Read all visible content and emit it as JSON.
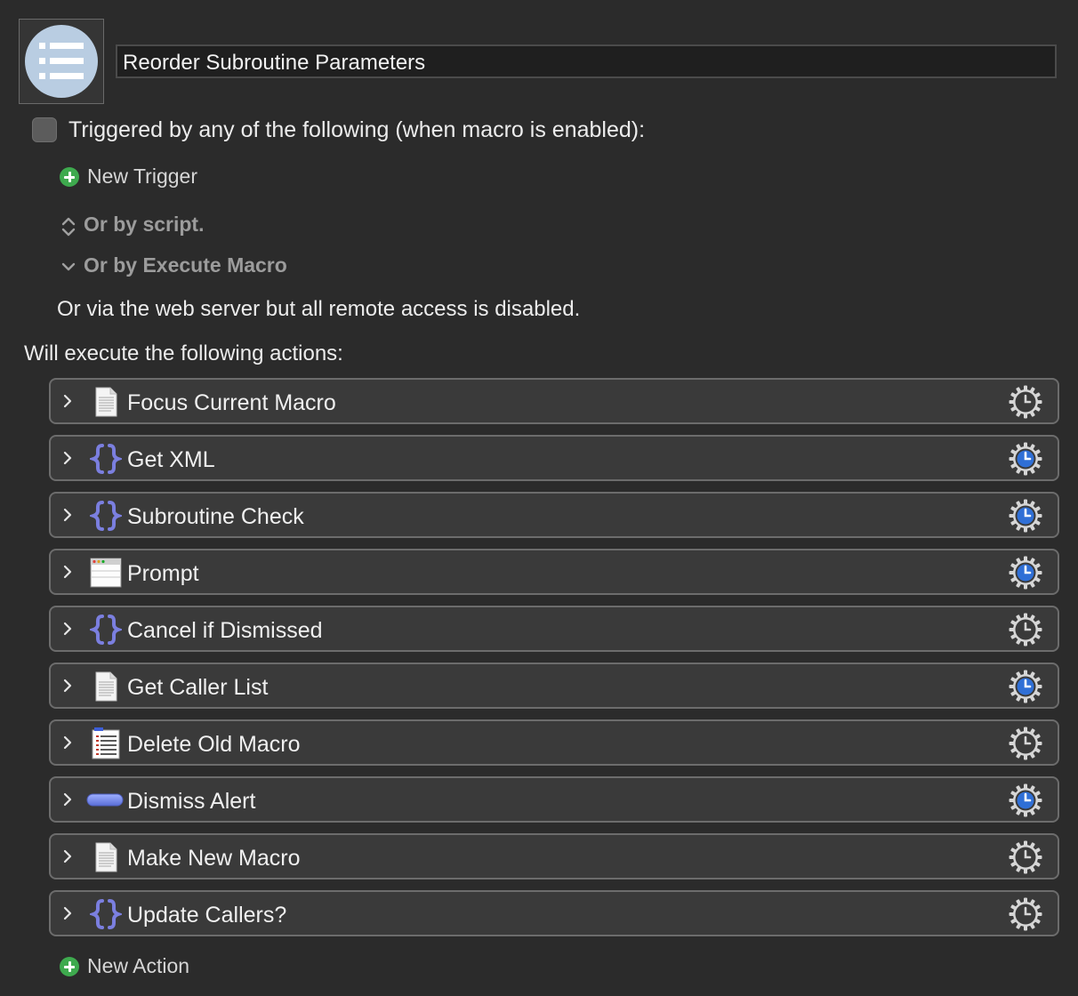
{
  "macro": {
    "name": "Reorder Subroutine Parameters",
    "icon": "list-icon"
  },
  "triggers": {
    "heading": "Triggered by any of the following (when macro is enabled):",
    "new_trigger_label": "New Trigger",
    "or_by_script": "Or by script.",
    "or_by_execute_macro": "Or by Execute Macro",
    "web_server_note": "Or via the web server but all remote access is disabled."
  },
  "actions_heading": "Will execute the following actions:",
  "actions": [
    {
      "label": "Focus Current Macro",
      "icon": "text-document-icon",
      "timeout_active": false
    },
    {
      "label": "Get XML",
      "icon": "braces-icon",
      "timeout_active": true
    },
    {
      "label": "Subroutine Check",
      "icon": "braces-icon",
      "timeout_active": true
    },
    {
      "label": "Prompt",
      "icon": "window-icon",
      "timeout_active": true
    },
    {
      "label": "Cancel if Dismissed",
      "icon": "braces-icon",
      "timeout_active": false
    },
    {
      "label": "Get Caller List",
      "icon": "text-document-icon",
      "timeout_active": true
    },
    {
      "label": "Delete Old Macro",
      "icon": "list-document-icon",
      "timeout_active": false
    },
    {
      "label": "Dismiss Alert",
      "icon": "button-icon",
      "timeout_active": true
    },
    {
      "label": "Make New Macro",
      "icon": "text-document-icon",
      "timeout_active": false
    },
    {
      "label": "Update Callers?",
      "icon": "braces-icon",
      "timeout_active": false
    }
  ],
  "new_action_label": "New Action",
  "colors": {
    "background": "#2b2b2b",
    "row_background": "#3a3a3a",
    "row_border": "#6c6c6c",
    "braces": "#7b7fe0",
    "timeout_blue": "#2f6fd6",
    "plus_green": "#3eaa4e"
  }
}
